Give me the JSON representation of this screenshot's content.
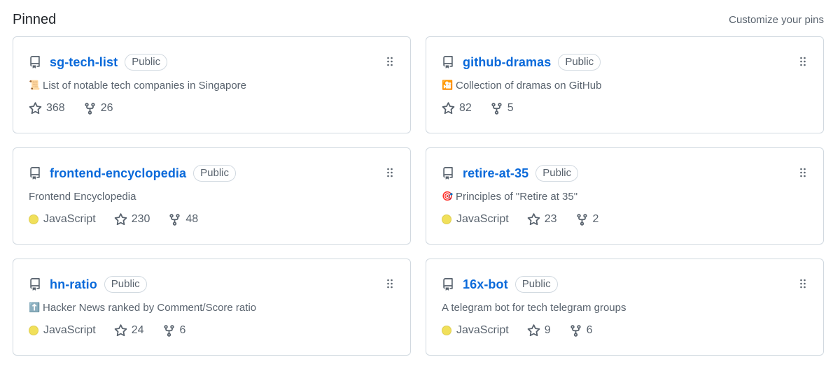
{
  "header": {
    "title": "Pinned",
    "customize_label": "Customize your pins"
  },
  "colors": {
    "link": "#0969da",
    "muted": "#59636e",
    "border": "#d1d9e0",
    "javascript": "#f1e05a"
  },
  "cards": [
    {
      "name": "sg-tech-list",
      "visibility": "Public",
      "emoji": "📜",
      "description": "List of notable tech companies in Singapore",
      "language": "",
      "stars": "368",
      "forks": "26"
    },
    {
      "name": "github-dramas",
      "visibility": "Public",
      "emoji": "🎦",
      "description": "Collection of dramas on GitHub",
      "language": "",
      "stars": "82",
      "forks": "5"
    },
    {
      "name": "frontend-encyclopedia",
      "visibility": "Public",
      "emoji": "",
      "description": "Frontend Encyclopedia",
      "language": "JavaScript",
      "stars": "230",
      "forks": "48"
    },
    {
      "name": "retire-at-35",
      "visibility": "Public",
      "emoji": "🎯",
      "description": "Principles of \"Retire at 35\"",
      "language": "JavaScript",
      "stars": "23",
      "forks": "2"
    },
    {
      "name": "hn-ratio",
      "visibility": "Public",
      "emoji": "⬆️",
      "description": "Hacker News ranked by Comment/Score ratio",
      "language": "JavaScript",
      "stars": "24",
      "forks": "6"
    },
    {
      "name": "16x-bot",
      "visibility": "Public",
      "emoji": "",
      "description": "A telegram bot for tech telegram groups",
      "language": "JavaScript",
      "stars": "9",
      "forks": "6"
    }
  ]
}
